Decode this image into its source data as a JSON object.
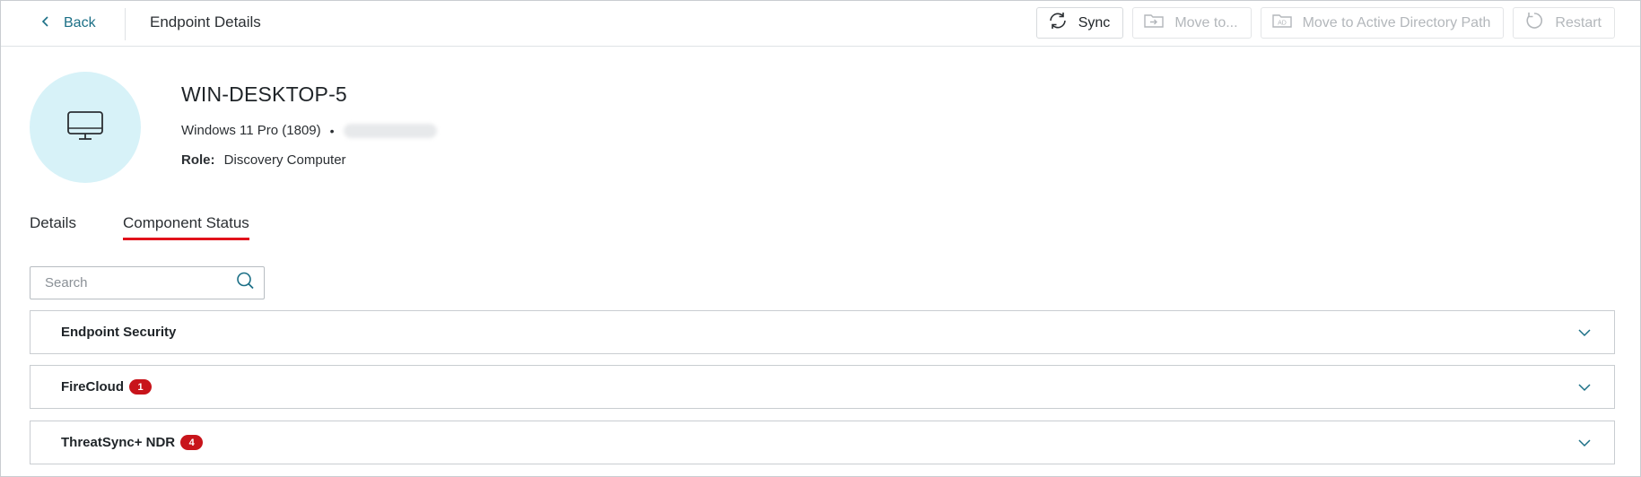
{
  "topbar": {
    "back_label": "Back",
    "page_title": "Endpoint Details",
    "actions": [
      {
        "label": "Sync",
        "icon": "sync-icon",
        "enabled": true
      },
      {
        "label": "Move to...",
        "icon": "folder-move-icon",
        "enabled": false
      },
      {
        "label": "Move to Active Directory Path",
        "icon": "ad-icon",
        "enabled": false
      },
      {
        "label": "Restart",
        "icon": "restart-icon",
        "enabled": false
      }
    ]
  },
  "endpoint": {
    "icon": "computer-monitor-icon",
    "name": "WIN-DESKTOP-5",
    "os": "Windows 11 Pro (1809)",
    "separator": "•",
    "role_label": "Role:",
    "role_value": "Discovery Computer"
  },
  "tabs": [
    {
      "label": "Details",
      "active": false
    },
    {
      "label": "Component Status",
      "active": true
    }
  ],
  "search": {
    "placeholder": "Search",
    "value": ""
  },
  "components": [
    {
      "label": "Endpoint Security",
      "badge": null
    },
    {
      "label": "FireCloud",
      "badge": "1"
    },
    {
      "label": "ThreatSync+ NDR",
      "badge": "4"
    }
  ],
  "colors": {
    "accent_link": "#1b6f86",
    "active_tab_underline": "#e1121b",
    "badge_red": "#c8141b",
    "avatar_bg": "#d7f2f8"
  }
}
